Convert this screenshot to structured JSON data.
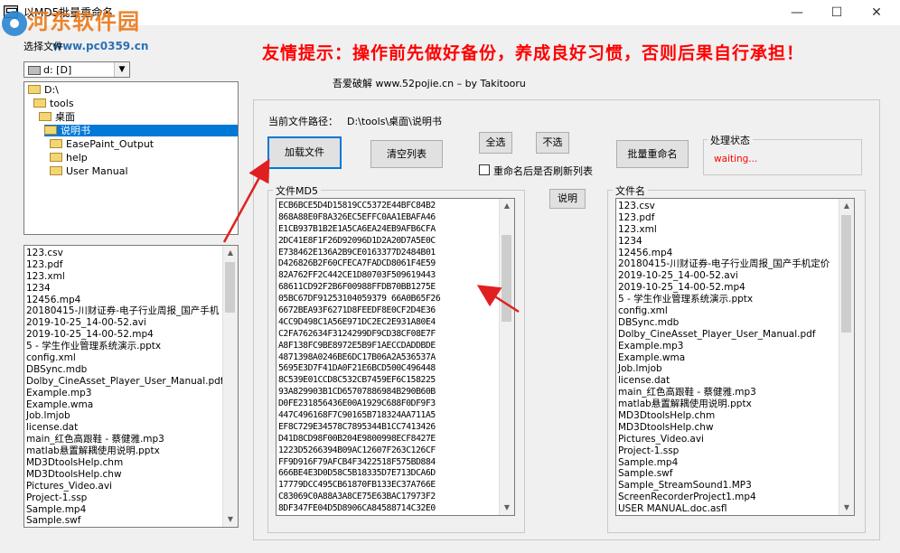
{
  "window": {
    "title": "以MD5批量重命名",
    "minimize_icon": "minimize-icon",
    "maximize_icon": "maximize-icon",
    "close_icon": "close-icon"
  },
  "watermark": {
    "name": "河东软件园",
    "url": "www.pc0359.cn"
  },
  "left_panel": {
    "select_file_label": "选择文件",
    "drive": "d: [D]",
    "tree": [
      {
        "label": "D:\\",
        "level": 0,
        "selected": false,
        "open": true
      },
      {
        "label": "tools",
        "level": 1,
        "selected": false,
        "open": true
      },
      {
        "label": "桌面",
        "level": 2,
        "selected": false,
        "open": true
      },
      {
        "label": "说明书",
        "level": 3,
        "selected": true,
        "open": true
      },
      {
        "label": "EasePaint_Output",
        "level": 4,
        "selected": false,
        "open": false
      },
      {
        "label": "help",
        "level": 4,
        "selected": false,
        "open": false
      },
      {
        "label": "User Manual",
        "level": 4,
        "selected": false,
        "open": false
      }
    ],
    "files": [
      "123.csv",
      "123.pdf",
      "123.xml",
      "1234",
      "12456.mp4",
      "20180415-川财证券-电子行业周报_国产手机",
      "2019-10-25_14-00-52.avi",
      "2019-10-25_14-00-52.mp4",
      "5 - 学生作业管理系统演示.pptx",
      "config.xml",
      "DBSync.mdb",
      "Dolby_CineAsset_Player_User_Manual.pdf",
      "Example.mp3",
      "Example.wma",
      "Job.lmjob",
      "license.dat",
      "main_红色高跟鞋 - 蔡健雅.mp3",
      "matlab悬置解耦使用说明.pptx",
      "MD3DtoolsHelp.chm",
      "MD3DtoolsHelp.chw",
      "Pictures_Video.avi",
      "Project-1.ssp",
      "Sample.mp4",
      "Sample.swf"
    ]
  },
  "header": {
    "warning": "友情提示：操作前先做好备份，养成良好习惯，否则后果自行承担！",
    "credit": "吾爱破解    www.52pojie.cn  – by Takitooru"
  },
  "main": {
    "path_label": "当前文件路径：",
    "path_value": "D:\\tools\\桌面\\说明书",
    "load_button": "加载文件",
    "clear_button": "清空列表",
    "select_all_button": "全选",
    "deselect_button": "不选",
    "batch_rename_button": "批量重命名",
    "refresh_label": "重命名后是否刷新列表",
    "refresh_checked": false,
    "status_title": "处理状态",
    "status_value": "waiting...",
    "explain_button": "说明",
    "md5_title": "文件MD5",
    "name_title": "文件名",
    "md5_list": [
      "ECB6BCE5D4D15819CC5372E44BFC84B2",
      "868A88E0F8A326EC5EFFC0AA1EBAFA46",
      "E1CB937B1B2E1A5CA6EA24EB9AFB6CFA",
      "2DC41E8F1F26D92096D1D2A20D7A5E0C",
      "E738462E136A2B9CE0163377D2484B01",
      "D426826B2F60CFECA7FADCD8061F4E59",
      "82A762FF2C442CE1D80703F509619443",
      "68611CD92F2B6F00988FFDB70BB1275E",
      "05BC67DF91253104059379 66A0B65F26",
      "6672BEA93F6271D8FEEDF8E0CF2D4E36",
      "4CC9D498C1A56E971DC2EC2E931A80E4",
      "C2FA762634F3124299DF9CD38CF08E7F",
      "A8F138FC9BE8972E5B9F1AECCDADDBDE",
      "4871398A0246BE6DC17B06A2A536537A",
      "5695E3D7F41DA0F21E6BCD500C496448",
      "8C539E01CCD8C532CB7459EF6C158225",
      "93A829903B1CD65707886984B290B60B",
      "D0FE231856436E00A1929C688F0DF9F3",
      "447C496168F7C90165B718324AA711A5",
      "EF8C729E34578C7895344B1CC7413426",
      "D41D8CD98F00B204E9800998ECF8427E",
      "1223D5266394B09AC12607F263C126CF",
      "FF9D916F79AFCB4F3422518F575BD884",
      "666BE4E3D0D58C5B18335D7E713DCA6D",
      "17779DCC495CB61870FB133EC37A766E",
      "C83069C0A88A3A8CE75E63BAC17973F2",
      "8DF347FE04D5D8906CA84588714C32E0"
    ],
    "name_list": [
      "123.csv",
      "123.pdf",
      "123.xml",
      "1234",
      "12456.mp4",
      "20180415-川财证券-电子行业周报_国产手机定价",
      "2019-10-25_14-00-52.avi",
      "2019-10-25_14-00-52.mp4",
      "5 - 学生作业管理系统演示.pptx",
      "config.xml",
      "DBSync.mdb",
      "Dolby_CineAsset_Player_User_Manual.pdf",
      "Example.mp3",
      "Example.wma",
      "Job.lmjob",
      "license.dat",
      "main_红色高跟鞋 - 蔡健雅.mp3",
      "matlab悬置解耦使用说明.pptx",
      "MD3DtoolsHelp.chm",
      "MD3DtoolsHelp.chw",
      "Pictures_Video.avi",
      "Project-1.ssp",
      "Sample.mp4",
      "Sample.swf",
      "Sample_StreamSound1.MP3",
      "ScreenRecorderProject1.mp4",
      "USER MANUAL.doc.asfl"
    ]
  },
  "colors": {
    "warning": "#ff0000",
    "status": "#ff0000",
    "selection": "#0078d7",
    "arrow": "#e02020",
    "watermark": "#ea7e23"
  }
}
